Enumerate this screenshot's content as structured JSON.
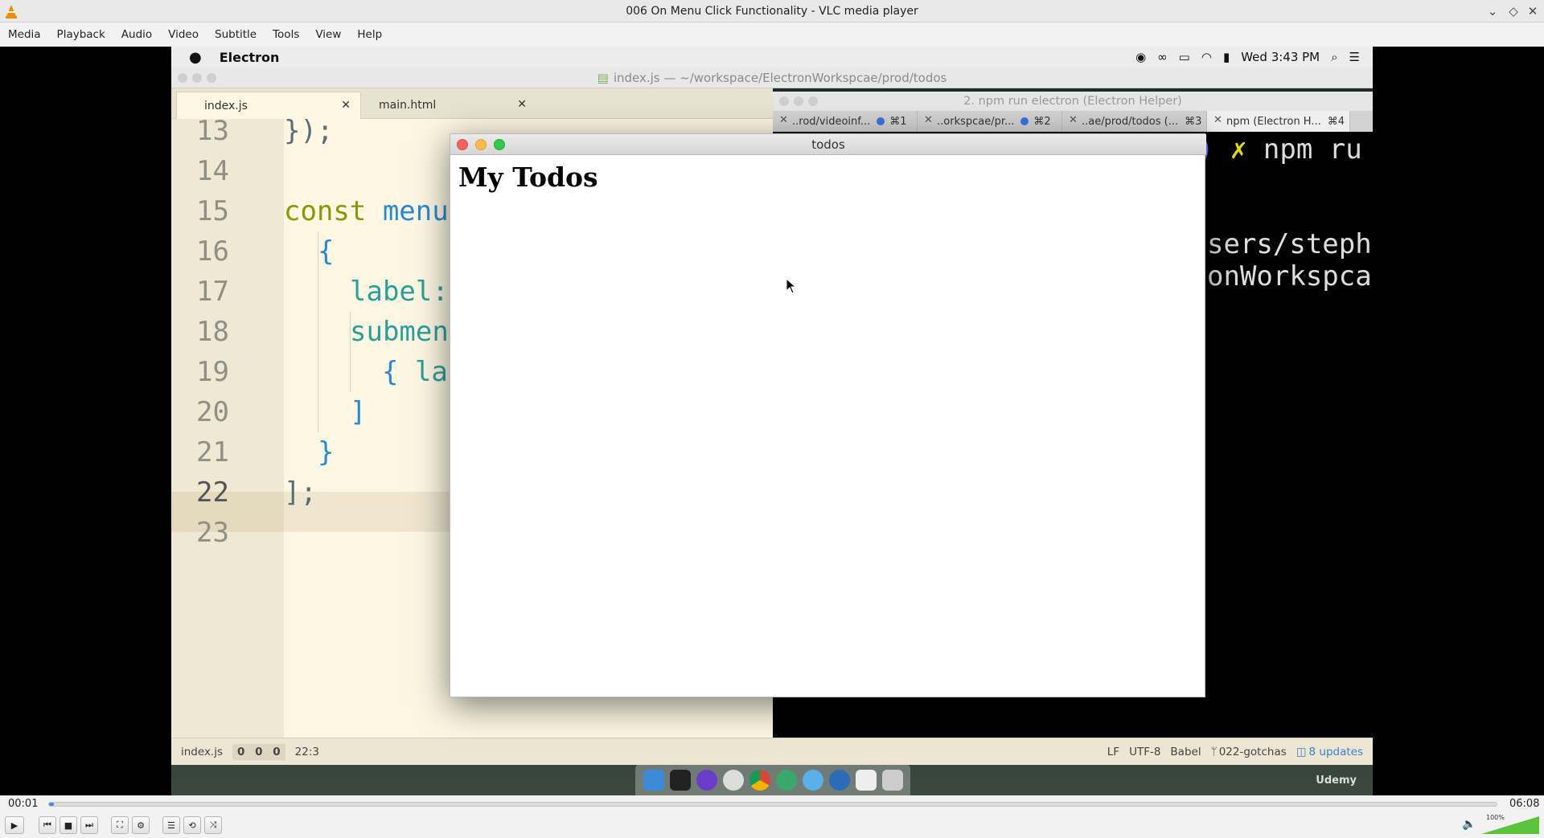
{
  "vlc": {
    "title": "006 On Menu Click Functionality - VLC media player",
    "menu": [
      "Media",
      "Playback",
      "Audio",
      "Video",
      "Subtitle",
      "Tools",
      "View",
      "Help"
    ],
    "time_elapsed": "00:01",
    "time_total": "06:08",
    "progress_fraction": 0.003,
    "volume_label": "100%",
    "volume_fraction": 1.0
  },
  "mac": {
    "app_name": "Electron",
    "clock": "Wed 3:43 PM"
  },
  "atom": {
    "title": "index.js — ~/workspace/ElectronWorkspcae/prod/todos",
    "tabs": [
      {
        "label": "index.js"
      },
      {
        "label": "main.html"
      }
    ],
    "line_numbers": [
      "13",
      "14",
      "15",
      "16",
      "17",
      "18",
      "19",
      "20",
      "21",
      "22",
      "23"
    ],
    "code": {
      "l13": "});",
      "l15_kw": "const",
      "l15_id": " menu",
      "l16": "{",
      "l17": "label:",
      "l18": "submen",
      "l19_a": "{",
      "l19_b": " la",
      "l20": "]",
      "l21": "}",
      "l22": "];"
    },
    "status": {
      "file": "index.js",
      "counts": [
        "0",
        "0",
        "0"
      ],
      "cursor": "22:3",
      "line_ending": "LF",
      "encoding": "UTF-8",
      "grammar": "Babel",
      "branch": "022-gotchas",
      "updates": "8 updates"
    }
  },
  "terminal": {
    "title": "2. npm run electron (Electron Helper)",
    "tabs": [
      {
        "label": "..rod/videoinf...",
        "shortcut": "⌘1"
      },
      {
        "label": "..orkspcae/pr...",
        "shortcut": "⌘2"
      },
      {
        "label": "..ae/prod/todos (...",
        "shortcut": "⌘3"
      },
      {
        "label": "npm (Electron H...",
        "shortcut": "⌘4"
      }
    ],
    "lines": {
      "prompt_tail": ")",
      "prompt_x": "✗",
      "cmd": " npm ru",
      "path1": "sers/steph",
      "path2": "onWorkspca"
    }
  },
  "todos": {
    "window_title": "todos",
    "heading": "My Todos"
  },
  "watermark": "Udemy",
  "colors": {
    "vlc_orange": "#f08c00",
    "progress_blue": "#3a8fe0",
    "mac_red": "#fc605c",
    "mac_yellow": "#fdbc40",
    "mac_green": "#34c84a"
  }
}
